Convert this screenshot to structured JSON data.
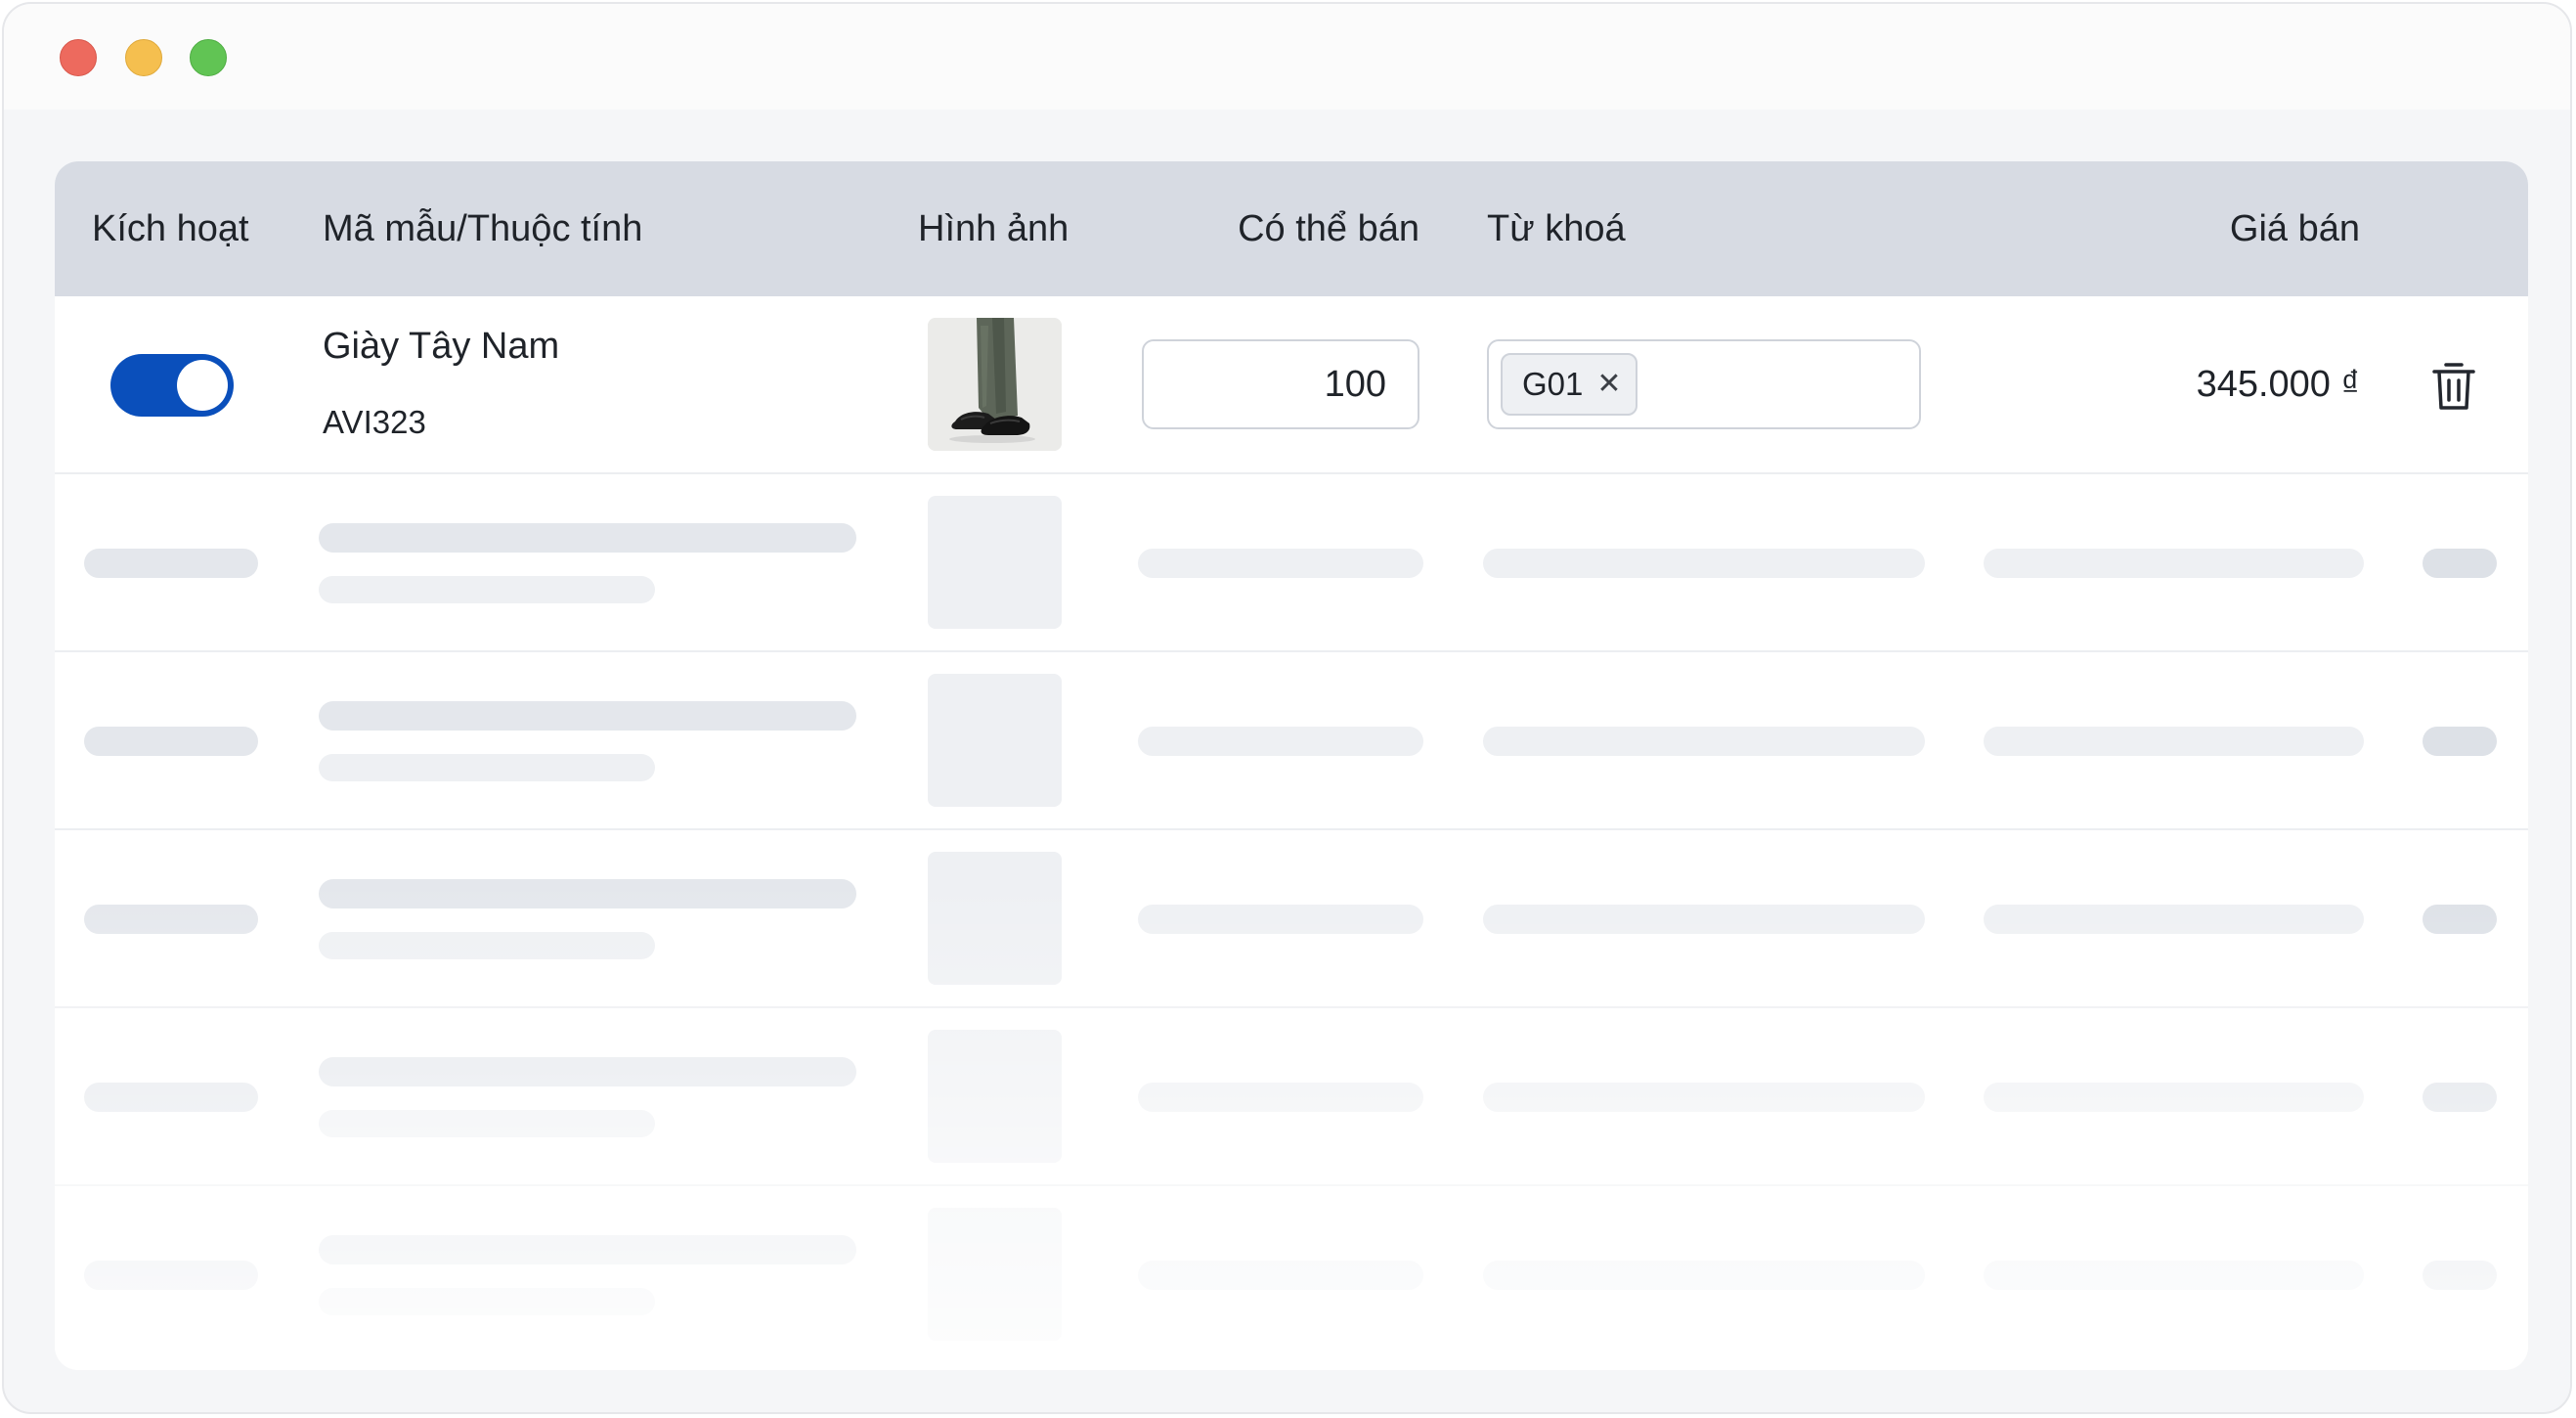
{
  "window": {
    "controls": [
      "close",
      "minimize",
      "maximize"
    ]
  },
  "table": {
    "headers": {
      "active": "Kích hoạt",
      "sku": "Mã mẫu/Thuộc tính",
      "image": "Hình ảnh",
      "available": "Có thể bán",
      "keywords": "Từ khoá",
      "price": "Giá bán"
    },
    "rows": [
      {
        "active": true,
        "name": "Giày Tây Nam",
        "sku": "AVI323",
        "image_icon": "shoe-product-photo",
        "available": "100",
        "keywords": [
          "G01"
        ],
        "price": "345.000 ₫"
      }
    ],
    "skeleton_rows": 5
  },
  "colors": {
    "accent": "#0a4fbb",
    "header_bg": "#d7dbe3",
    "skeleton": "#e4e7ec"
  }
}
